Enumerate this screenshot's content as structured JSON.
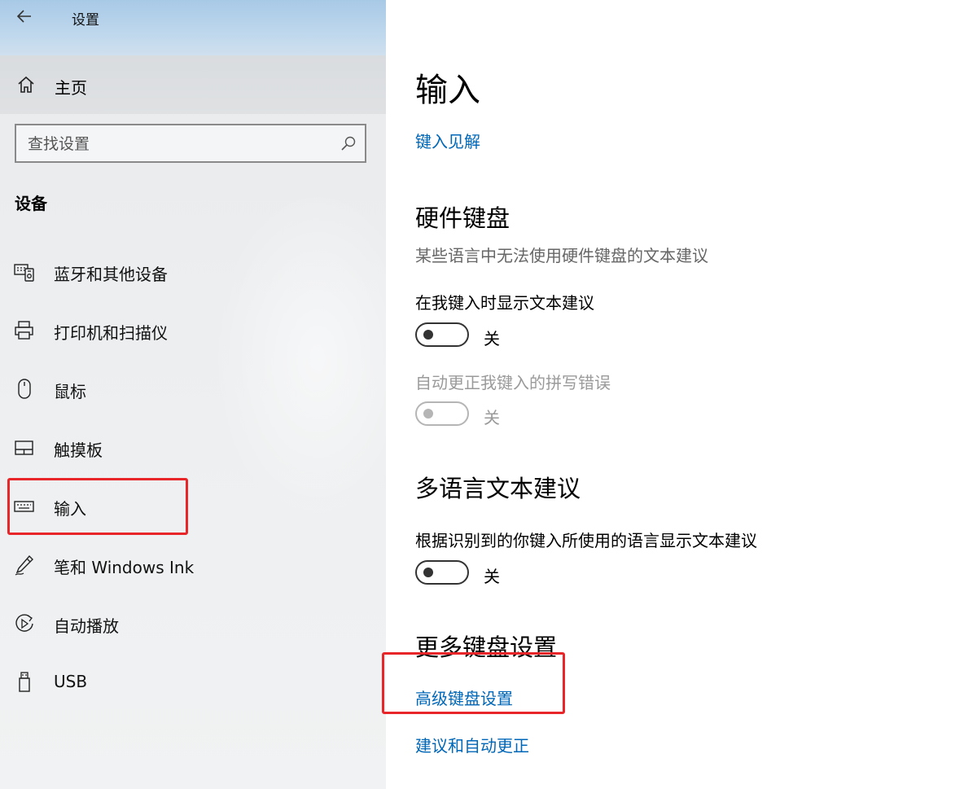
{
  "window": {
    "title": "设置"
  },
  "sidebar": {
    "home_label": "主页",
    "search_placeholder": "查找设置",
    "section_heading": "设备",
    "items": [
      {
        "label": "蓝牙和其他设备",
        "icon": "bluetooth-devices-icon"
      },
      {
        "label": "打印机和扫描仪",
        "icon": "printer-icon"
      },
      {
        "label": "鼠标",
        "icon": "mouse-icon"
      },
      {
        "label": "触摸板",
        "icon": "touchpad-icon"
      },
      {
        "label": "输入",
        "icon": "keyboard-icon",
        "highlighted": true
      },
      {
        "label": "笔和 Windows Ink",
        "icon": "pen-icon"
      },
      {
        "label": "自动播放",
        "icon": "autoplay-icon"
      },
      {
        "label": "USB",
        "icon": "usb-icon"
      }
    ]
  },
  "main": {
    "title": "输入",
    "typing_insights_link": "键入见解",
    "hardware_keyboard": {
      "heading": "硬件键盘",
      "description": "某些语言中无法使用硬件键盘的文本建议",
      "show_suggestions": {
        "label": "在我键入时显示文本建议",
        "state": "关",
        "on": false,
        "enabled": true
      },
      "autocorrect": {
        "label": "自动更正我键入的拼写错误",
        "state": "关",
        "on": false,
        "enabled": false
      }
    },
    "multilingual": {
      "heading": "多语言文本建议",
      "option": {
        "label": "根据识别到的你键入所使用的语言显示文本建议",
        "state": "关",
        "on": false,
        "enabled": true
      }
    },
    "more_keyboard": {
      "heading": "更多键盘设置",
      "advanced_link": "高级键盘设置",
      "suggestions_link": "建议和自动更正"
    }
  },
  "colors": {
    "accent_link": "#0067b8",
    "highlight_box": "#e8262a",
    "titlebar": "#bcd6ec"
  }
}
